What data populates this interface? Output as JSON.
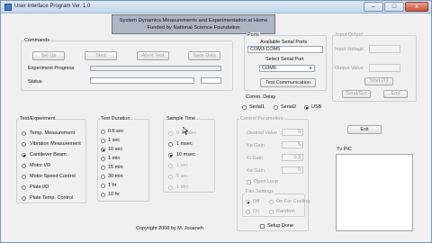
{
  "window": {
    "title": "User Interface Program Ver. 1.0",
    "minimize": "–",
    "maximize": "□",
    "close": "x"
  },
  "header": {
    "line1": "System Dynamics Measurements and Experimentation at Home",
    "line2": "Funded by National Science Foundation"
  },
  "commands": {
    "title": "Commands",
    "buttons": [
      "Set Up",
      "Start",
      "Abort Test",
      "Save Data"
    ],
    "progress_label": "Experiment Progress",
    "progress": 0,
    "status_label": "Status"
  },
  "ports": {
    "title": "Ports",
    "available_label": "Available Serial Ports",
    "available_value": "COM3 COM5",
    "select_label": "Select Serial Port",
    "select_value": "COM5",
    "test_button": "Test Communication"
  },
  "input_output": {
    "title": "Input Output",
    "input_voltage_label": "Input Voltage",
    "output_value_label": "Output Value",
    "start_io": "Start I/O",
    "send_get": "Send/Get",
    "end": "End"
  },
  "comm_delay": {
    "title": "Comm. Delay",
    "options": [
      "USB",
      "Serial1",
      "Serial2"
    ],
    "selected": "USB"
  },
  "control_params": {
    "title": "Control Parameters",
    "fields": [
      {
        "label": "Desired Value",
        "value": "0"
      },
      {
        "label": "Kp Gain",
        "value": "5"
      },
      {
        "label": "Ki Gain",
        "value": "0.3"
      },
      {
        "label": "Kd Gain",
        "value": "0"
      }
    ],
    "open_loop": "Open Loop",
    "fan_settings": "Fan Settings",
    "fan_options": [
      "Off",
      "On For Cooling",
      "On",
      "Random"
    ],
    "fan_selected": "Off"
  },
  "exit_button": "Exit",
  "tv_pic": {
    "label": "Tv PIC"
  },
  "test_experiment": {
    "title": "Test/Experiment",
    "options": [
      "Temp. Measurement",
      "Vibration Measurement",
      "Cantilever Beam",
      "Motor I/O",
      "Motor Speed Control",
      "Plate I/O",
      "Plate Temp. Control"
    ],
    "selected": "Cantilever Beam"
  },
  "test_duration": {
    "title": "Test Duration",
    "options": [
      "0.6 sec",
      "1 sec",
      "10 sec",
      "1 min",
      "15 min",
      "30 min",
      "1 hr",
      "10 hr"
    ],
    "selected": "10 sec"
  },
  "sample_time": {
    "title": "Sample Time",
    "options": [
      "0.1 msec",
      "1 msec",
      "10 msec",
      "1 sec",
      "5 sec",
      "1 min"
    ],
    "selected": "10 msec",
    "enabled": [
      "1 msec",
      "10 msec"
    ]
  },
  "setup_done": "Setup Done",
  "copyright": "Copyright 2008 by M. Jouaneh"
}
